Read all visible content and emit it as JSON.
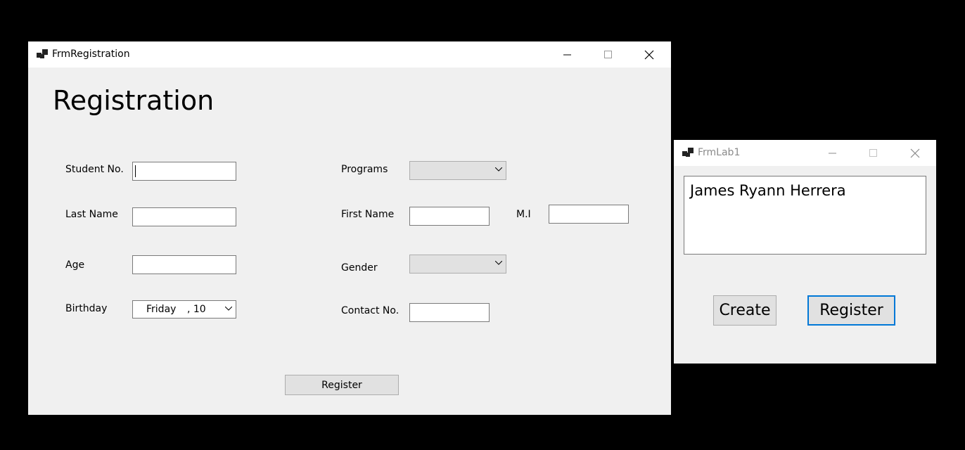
{
  "registration_window": {
    "title": "FrmRegistration",
    "icon": "app-window-icon",
    "heading": "Registration",
    "fields": {
      "student_no": {
        "label": "Student No.",
        "value": ""
      },
      "last_name": {
        "label": "Last Name",
        "value": ""
      },
      "age": {
        "label": "Age",
        "value": ""
      },
      "birthday": {
        "label": "Birthday",
        "day": "Friday",
        "date": ", 10"
      },
      "programs": {
        "label": "Programs",
        "value": ""
      },
      "first_name": {
        "label": "First Name",
        "value": ""
      },
      "mi": {
        "label": "M.I",
        "value": ""
      },
      "gender": {
        "label": "Gender",
        "value": ""
      },
      "contact_no": {
        "label": "Contact No.",
        "value": ""
      }
    },
    "register_label": "Register"
  },
  "lab_window": {
    "title": "FrmLab1",
    "icon": "app-window-icon",
    "display_text": "James Ryann Herrera",
    "create_label": "Create",
    "register_label": "Register"
  },
  "colors": {
    "window_bg": "#f0f0f0",
    "titlebar_bg": "#ffffff",
    "desktop_bg": "#000000",
    "focus_border": "#0078d7",
    "inactive_title": "#8a8a8a"
  }
}
